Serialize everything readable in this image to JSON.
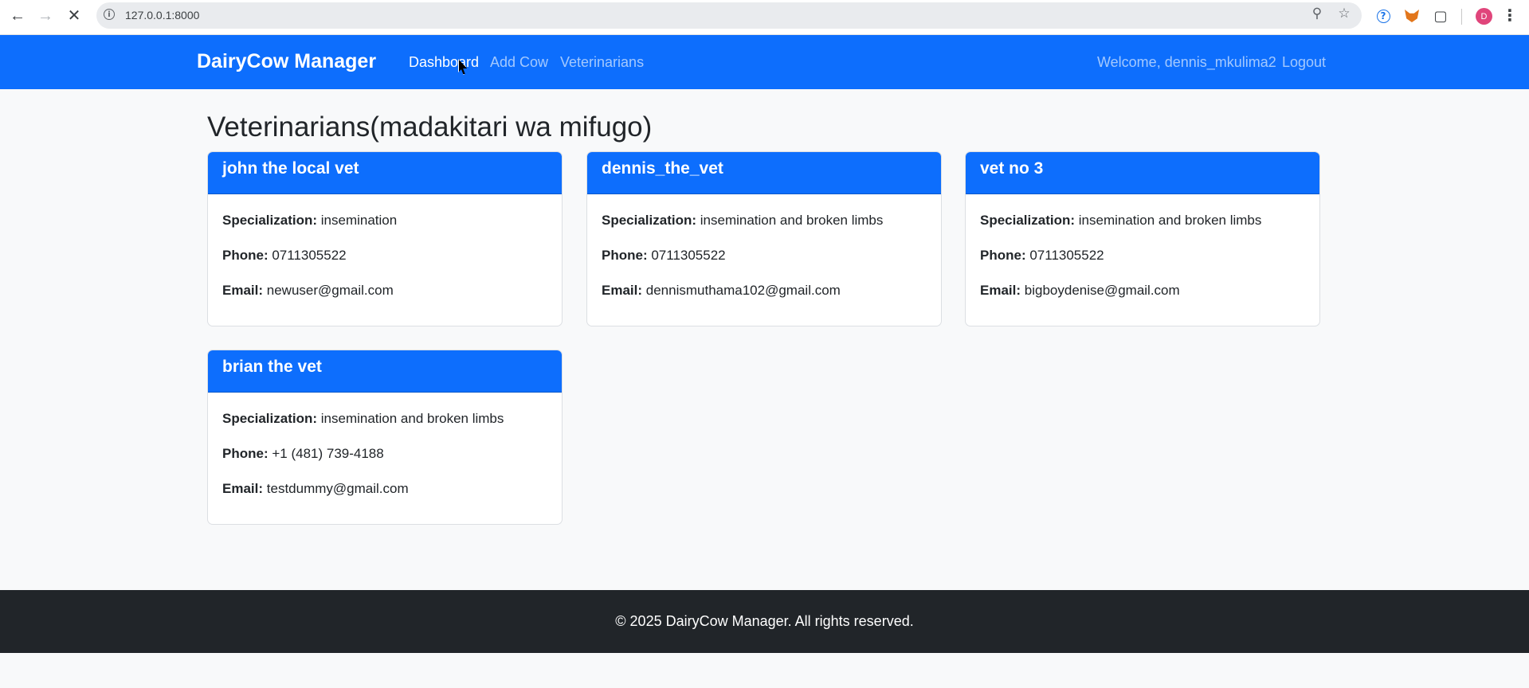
{
  "browser": {
    "url": "127.0.0.1:8000",
    "back_icon": "back-arrow-icon",
    "forward_icon": "forward-arrow-icon",
    "stop_icon": "close-icon",
    "profile_initial": "D"
  },
  "navbar": {
    "brand": "DairyCow Manager",
    "links": [
      "Dashboard",
      "Add Cow",
      "Veterinarians"
    ],
    "welcome": "Welcome, dennis_mkulima2",
    "logout": "Logout",
    "color": "#0d6efd"
  },
  "main": {
    "title": "Veterinarians(madakitari wa mifugo)",
    "labels": {
      "specialization": "Specialization:",
      "phone": "Phone:",
      "email": "Email:"
    },
    "vets": [
      {
        "name": "john the local vet",
        "specialization": "insemination",
        "phone": "0711305522",
        "email": "newuser@gmail.com"
      },
      {
        "name": "dennis_the_vet",
        "specialization": "insemination and broken limbs",
        "phone": "0711305522",
        "email": "dennismuthama102@gmail.com"
      },
      {
        "name": "vet no 3",
        "specialization": "insemination and broken limbs",
        "phone": "0711305522",
        "email": "bigboydenise@gmail.com"
      },
      {
        "name": "brian the vet",
        "specialization": "insemination and broken limbs",
        "phone": "+1 (481) 739-4188",
        "email": "testdummy@gmail.com"
      }
    ]
  },
  "footer": {
    "text": "© 2025 DairyCow Manager. All rights reserved."
  }
}
